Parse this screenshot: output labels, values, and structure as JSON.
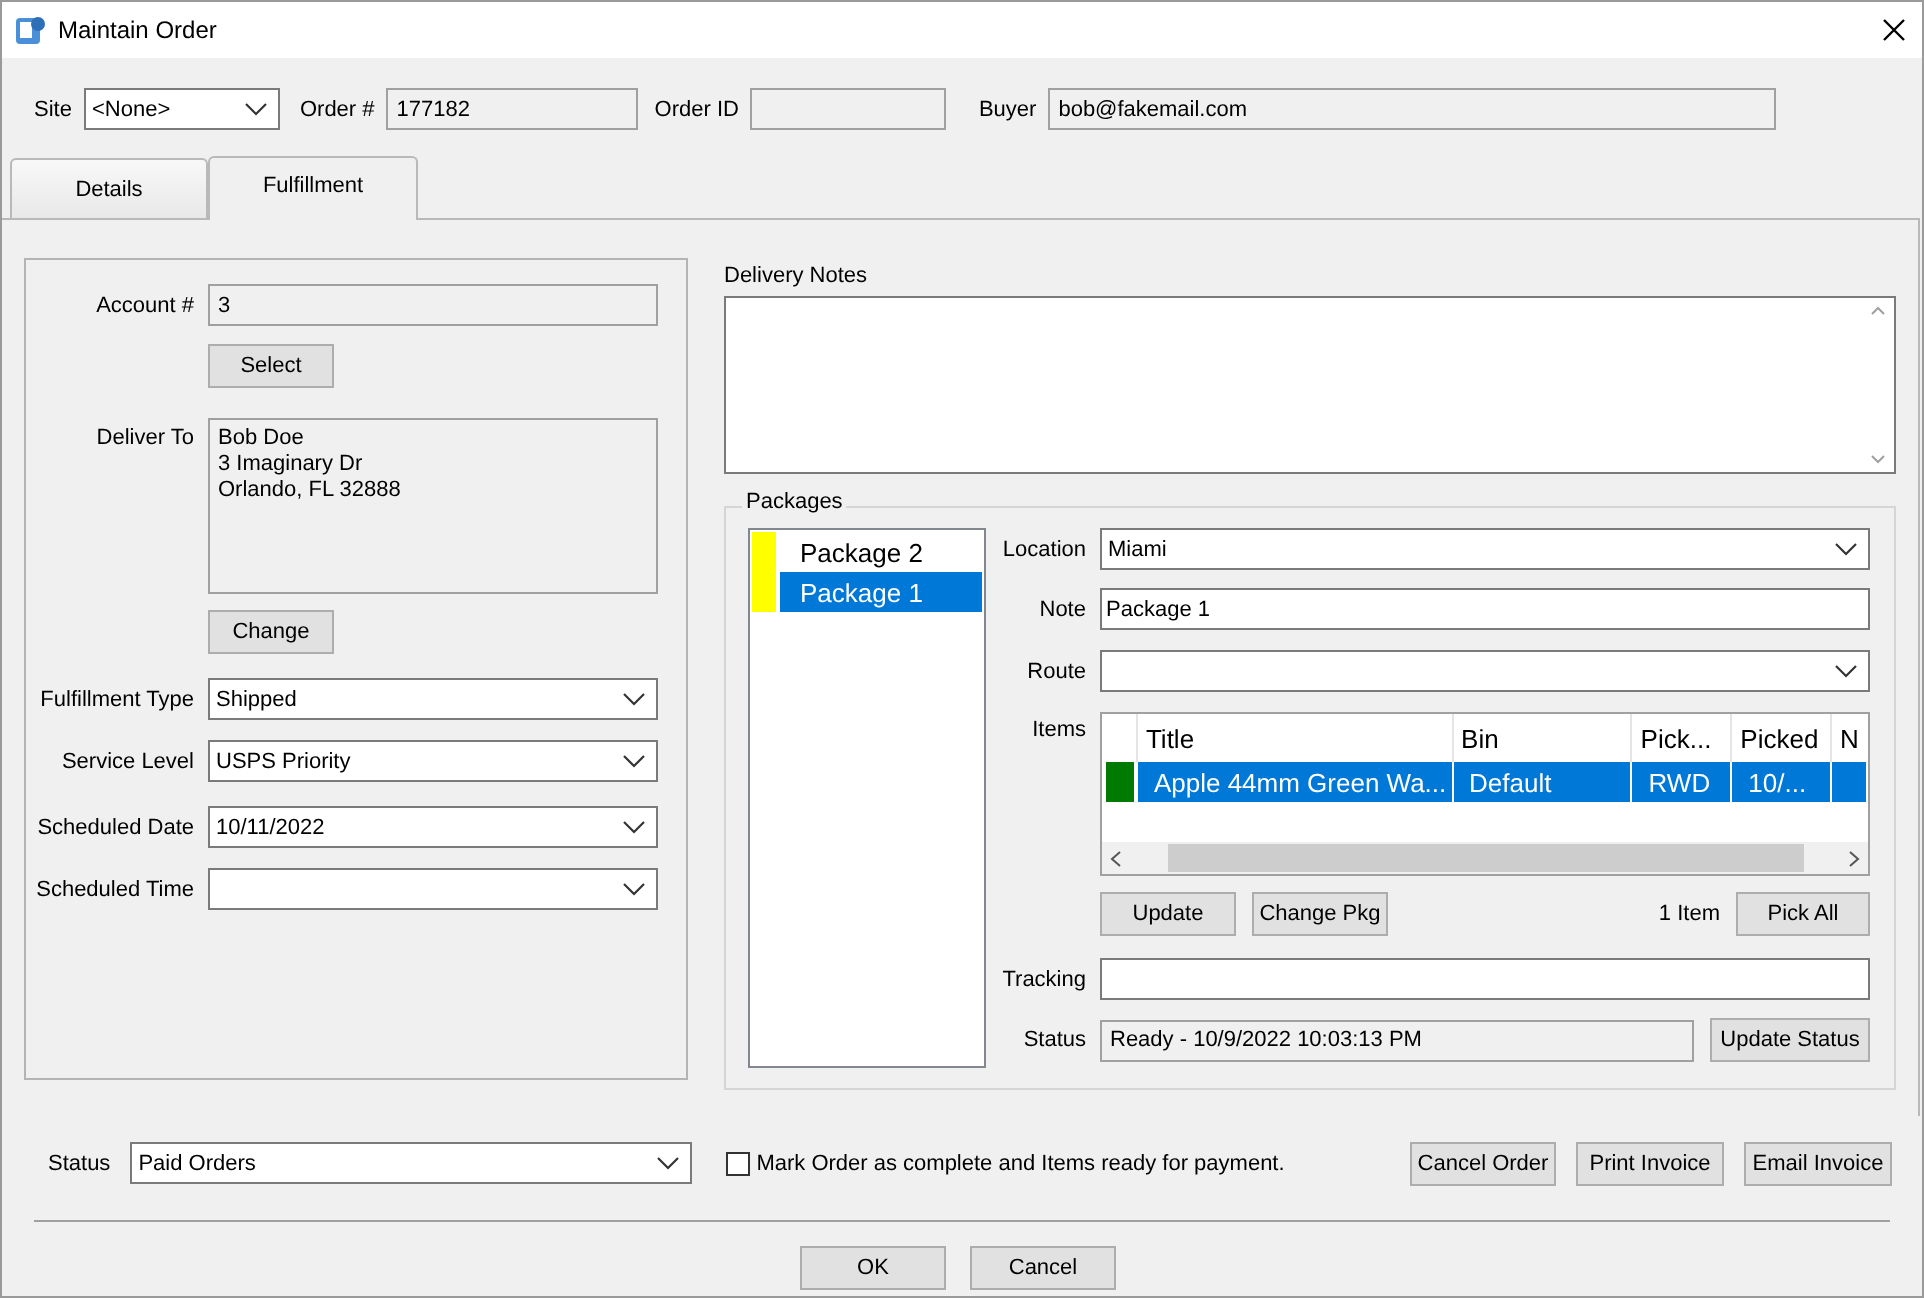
{
  "window": {
    "title": "Maintain Order"
  },
  "header": {
    "site": {
      "label": "Site",
      "value": "<None>"
    },
    "order_number": {
      "label": "Order #",
      "value": "177182"
    },
    "order_id": {
      "label": "Order ID"
    },
    "buyer": {
      "label": "Buyer",
      "value": "bob@fakemail.com"
    }
  },
  "tabs": [
    {
      "label": "Details",
      "selected": false
    },
    {
      "label": "Fulfillment",
      "selected": true
    }
  ],
  "fulfillment": {
    "account": {
      "label": "Account #",
      "value": "3"
    },
    "select_button": "Select",
    "deliver_to": {
      "label": "Deliver To",
      "lines": [
        "Bob Doe",
        "3 Imaginary Dr",
        "Orlando, FL  32888"
      ]
    },
    "change_button": "Change",
    "fields": [
      {
        "label": "Fulfillment Type",
        "value": "Shipped"
      },
      {
        "label": "Service Level",
        "value": "USPS Priority"
      },
      {
        "label": "Scheduled Date",
        "value": "10/11/2022"
      },
      {
        "label": "Scheduled Time"
      }
    ]
  },
  "delivery_notes": {
    "label": "Delivery Notes"
  },
  "packages": {
    "title": "Packages",
    "list": [
      {
        "name": "Package 2",
        "color": "#ffff00",
        "selected": false
      },
      {
        "name": "Package 1",
        "color": "#ffff00",
        "selected": true
      }
    ],
    "location": {
      "label": "Location",
      "value": "Miami"
    },
    "note": {
      "label": "Note",
      "value": "Package 1"
    },
    "route": {
      "label": "Route"
    },
    "items": {
      "label": "Items",
      "columns": [
        "Title",
        "Bin",
        "Pick...",
        "Picked",
        "N"
      ],
      "rows": [
        {
          "color": "#007a00",
          "selected": true,
          "cells": [
            "Apple 44mm Green Wa...",
            "Default",
            "RWD",
            "10/..."
          ]
        }
      ]
    },
    "update_button": "Update",
    "change_pkg_button": "Change Pkg",
    "item_count": "1 Item",
    "pick_all_button": "Pick All",
    "tracking": {
      "label": "Tracking"
    },
    "status": {
      "label": "Status",
      "value": "Ready - 10/9/2022 10:03:13 PM"
    },
    "update_status_button": "Update Status"
  },
  "order_status": {
    "label": "Status",
    "value": "Paid Orders"
  },
  "mark_complete": {
    "label": "Mark Order as complete and Items ready for payment.",
    "checked": false
  },
  "actions": [
    "Cancel Order",
    "Print Invoice",
    "Email Invoice"
  ],
  "dialog_buttons": [
    "OK",
    "Cancel"
  ]
}
